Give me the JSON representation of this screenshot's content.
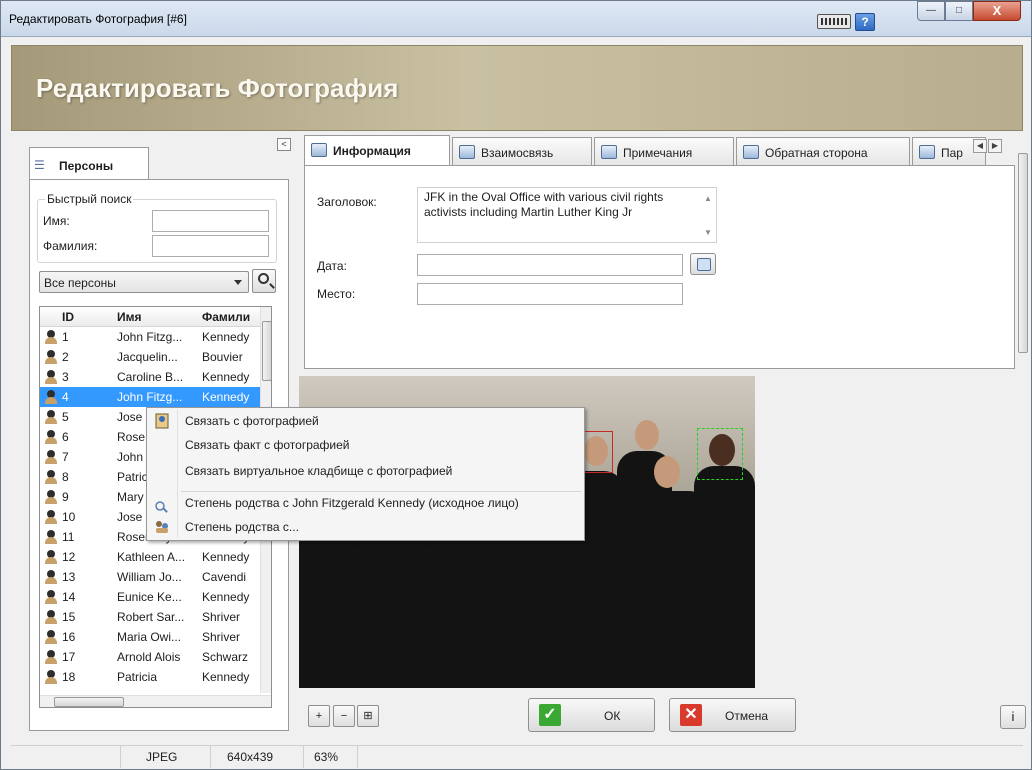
{
  "window": {
    "title": "Редактировать Фотография [#6]",
    "help_label": "?",
    "min_label": "—",
    "max_label": "□",
    "close_label": "X"
  },
  "header": {
    "title": "Редактировать Фотография"
  },
  "left_panel": {
    "collapse_label": "<",
    "tab_label": "Персоны",
    "quick_search": {
      "legend": "Быстрый поиск",
      "first_name_label": "Имя:",
      "last_name_label": "Фамилия:",
      "first_name_value": "",
      "last_name_value": ""
    },
    "filter_selected": "Все персоны",
    "grid": {
      "columns": [
        "ID",
        "Имя",
        "Фамили"
      ],
      "rows": [
        {
          "id": "1",
          "first": "John Fitzg...",
          "last": "Kennedy"
        },
        {
          "id": "2",
          "first": "Jacquelin...",
          "last": "Bouvier"
        },
        {
          "id": "3",
          "first": "Caroline B...",
          "last": "Kennedy"
        },
        {
          "id": "4",
          "first": "John Fitzg...",
          "last": "Kennedy"
        },
        {
          "id": "5",
          "first": "Jose",
          "last": ""
        },
        {
          "id": "6",
          "first": "Rose",
          "last": ""
        },
        {
          "id": "7",
          "first": "John",
          "last": ""
        },
        {
          "id": "8",
          "first": "Patric",
          "last": ""
        },
        {
          "id": "9",
          "first": "Mary",
          "last": ""
        },
        {
          "id": "10",
          "first": "Jose",
          "last": ""
        },
        {
          "id": "11",
          "first": "Rosemary",
          "last": "Kennedy"
        },
        {
          "id": "12",
          "first": "Kathleen A...",
          "last": "Kennedy"
        },
        {
          "id": "13",
          "first": "William Jo...",
          "last": "Cavendi"
        },
        {
          "id": "14",
          "first": "Eunice Ke...",
          "last": "Kennedy"
        },
        {
          "id": "15",
          "first": "Robert Sar...",
          "last": "Shriver"
        },
        {
          "id": "16",
          "first": "Maria Owi...",
          "last": "Shriver"
        },
        {
          "id": "17",
          "first": "Arnold Alois",
          "last": "Schwarz"
        },
        {
          "id": "18",
          "first": "Patricia",
          "last": "Kennedy"
        }
      ],
      "selected_index": 3
    }
  },
  "tabs": [
    {
      "label": "Информация",
      "active": true
    },
    {
      "label": "Взаимосвязь",
      "active": false
    },
    {
      "label": "Примечания",
      "active": false
    },
    {
      "label": "Обратная сторона",
      "active": false
    },
    {
      "label": "Пар",
      "active": false
    }
  ],
  "info_form": {
    "caption_label": "Заголовок:",
    "caption_value": "JFK in the Oval Office with various civil rights activists including Martin Luther King Jr",
    "date_label": "Дата:",
    "date_value": "",
    "place_label": "Место:",
    "place_value": ""
  },
  "context_menu": {
    "items": [
      "Связать с фотографией",
      "Связать факт с фотографией",
      "Связать виртуальное кладбище с фотографией",
      "Степень родства с John Fitzgerald Kennedy (исходное лицо)",
      "Степень родства с..."
    ]
  },
  "toolbar": {
    "ok_label": "ОК",
    "cancel_label": "Отмена",
    "info_label": "i",
    "zoom_in_label": "+",
    "zoom_out_label": "−",
    "fit_label": "⊞"
  },
  "status": {
    "format": "JPEG",
    "dimensions": "640x439",
    "zoom": "63%"
  },
  "colors": {
    "selection": "#3399ff",
    "banner": "#b8ad8d",
    "ok_green": "#3aa832",
    "cancel_red": "#d93a2b"
  }
}
